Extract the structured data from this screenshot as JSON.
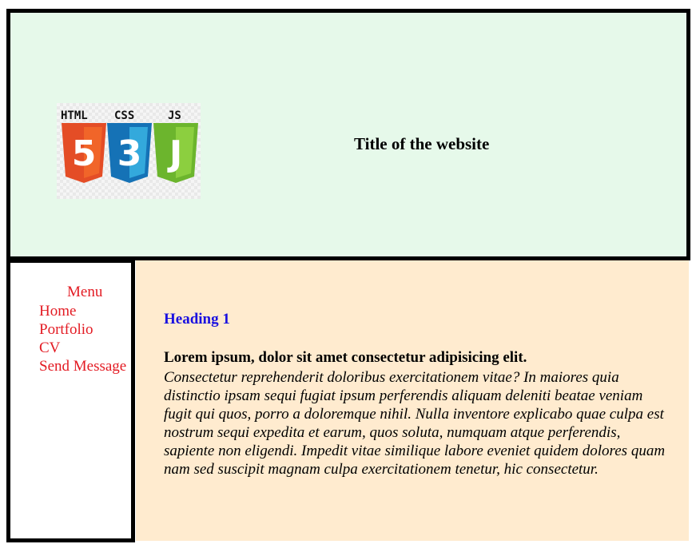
{
  "header": {
    "title": "Title of the website",
    "logo": {
      "labels": [
        "HTML",
        "CSS",
        "JS"
      ],
      "badges": [
        "5",
        "3",
        "J"
      ],
      "colors": [
        "#e44d26",
        "#1572b6",
        "#6cb52d"
      ]
    },
    "background": "#e6f9ea"
  },
  "sidebar": {
    "menu_title": "Menu",
    "items": [
      {
        "label": "Home"
      },
      {
        "label": "Portfolio"
      },
      {
        "label": "CV"
      },
      {
        "label": "Send Message"
      }
    ],
    "link_color": "#e31b23"
  },
  "main": {
    "heading": "Heading 1",
    "lead": "Lorem ipsum, dolor sit amet consectetur adipisicing elit.",
    "body": "Consectetur reprehenderit doloribus exercitationem vitae? In maiores quia distinctio ipsam sequi fugiat ipsum perferendis aliquam deleniti beatae veniam fugit qui quos, porro a doloremque nihil. Nulla inventore explicabo quae culpa est nostrum sequi expedita et earum, quos soluta, numquam atque perferendis, sapiente non eligendi. Impedit vitae similique labore eveniet quidem dolores quam nam sed suscipit magnam culpa exercitationem tenetur, hic consectetur.",
    "heading_color": "#1a10e0",
    "background": "#ffebcf"
  }
}
